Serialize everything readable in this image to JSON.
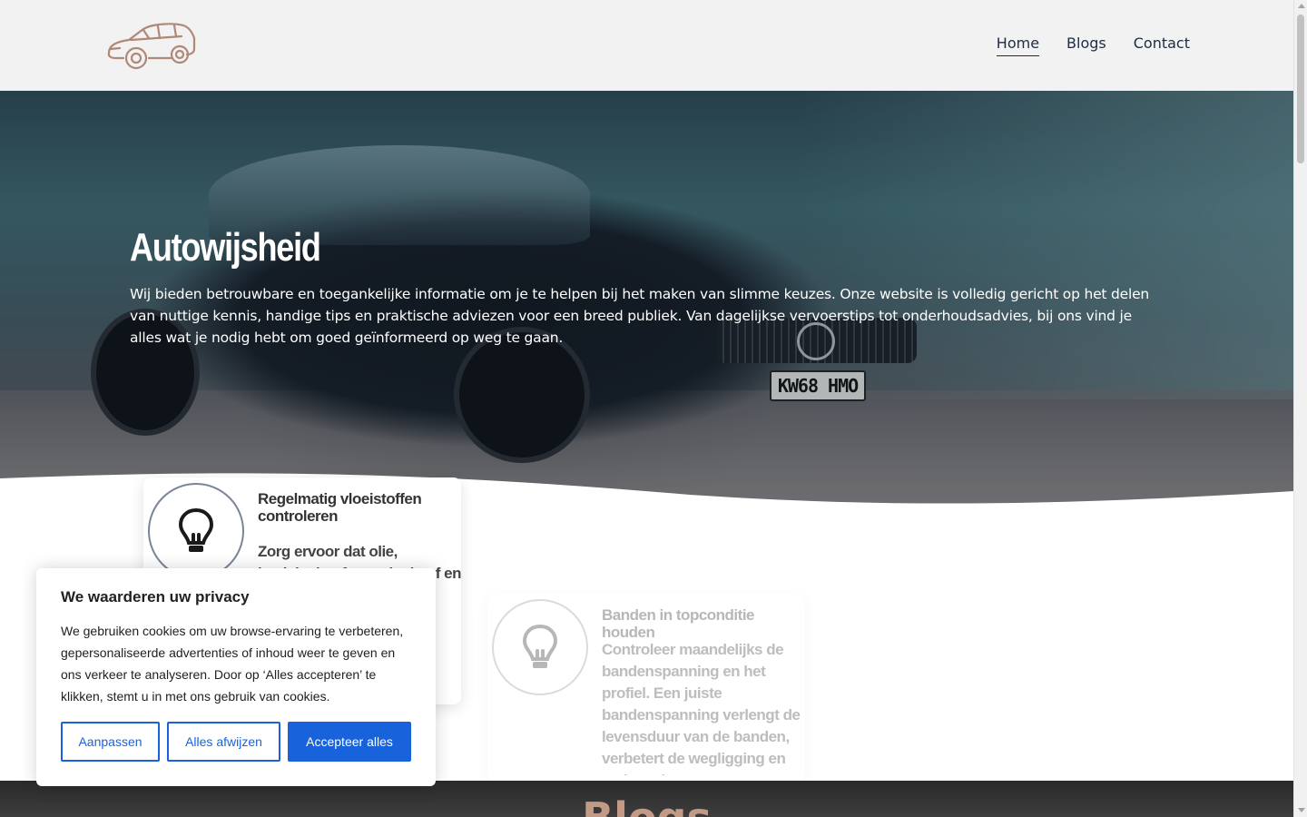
{
  "header": {
    "logo_icon": "car-outline-icon",
    "nav": [
      {
        "label": "Home",
        "active": true
      },
      {
        "label": "Blogs",
        "active": false
      },
      {
        "label": "Contact",
        "active": false
      }
    ]
  },
  "hero": {
    "title": "Autowijsheid",
    "text": "Wij bieden betrouwbare en toegankelijke informatie om je te helpen bij het maken van slimme keuzes. Onze website is volledig gericht op het delen van nuttige kennis, handige tips en praktische adviezen voor een breed publiek. Van dagelijkse vervoerstips tot onderhoudsadvies, bij ons vind je alles wat je nodig hebt om goed geïnformeerd op weg te gaan.",
    "plate": "KW68 HMO"
  },
  "features": [
    {
      "icon": "lightbulb-icon",
      "title": "Regelmatig vloeistoffen controleren",
      "desc": "Zorg ervoor dat olie, koelvloeistof, remvloeistof en"
    },
    {
      "icon": "lightbulb-icon",
      "title": "Banden in topconditie houden",
      "desc": "Controleer maandelijks de bandenspanning en het profiel. Een juiste bandenspanning verlengt de levensduur van de banden, verbetert de wegligging en verlaagt het brandstofverbruik."
    }
  ],
  "blogs": {
    "title": "Blogs"
  },
  "cookie": {
    "title": "We waarderen uw privacy",
    "text": "We gebruiken cookies om uw browse-ervaring te verbeteren, gepersonaliseerde advertenties of inhoud weer te geven en ons verkeer te analyseren. Door op ‘Alles accepteren’ te klikken, stemt u in met ons gebruik van cookies.",
    "btn_customize": "Aanpassen",
    "btn_reject": "Alles afwijzen",
    "btn_accept": "Accepteer alles"
  },
  "colors": {
    "accent": "#1863dc",
    "logo": "#b08878",
    "nav_text": "#1f2a44",
    "blogs_title": "#c29a86"
  }
}
